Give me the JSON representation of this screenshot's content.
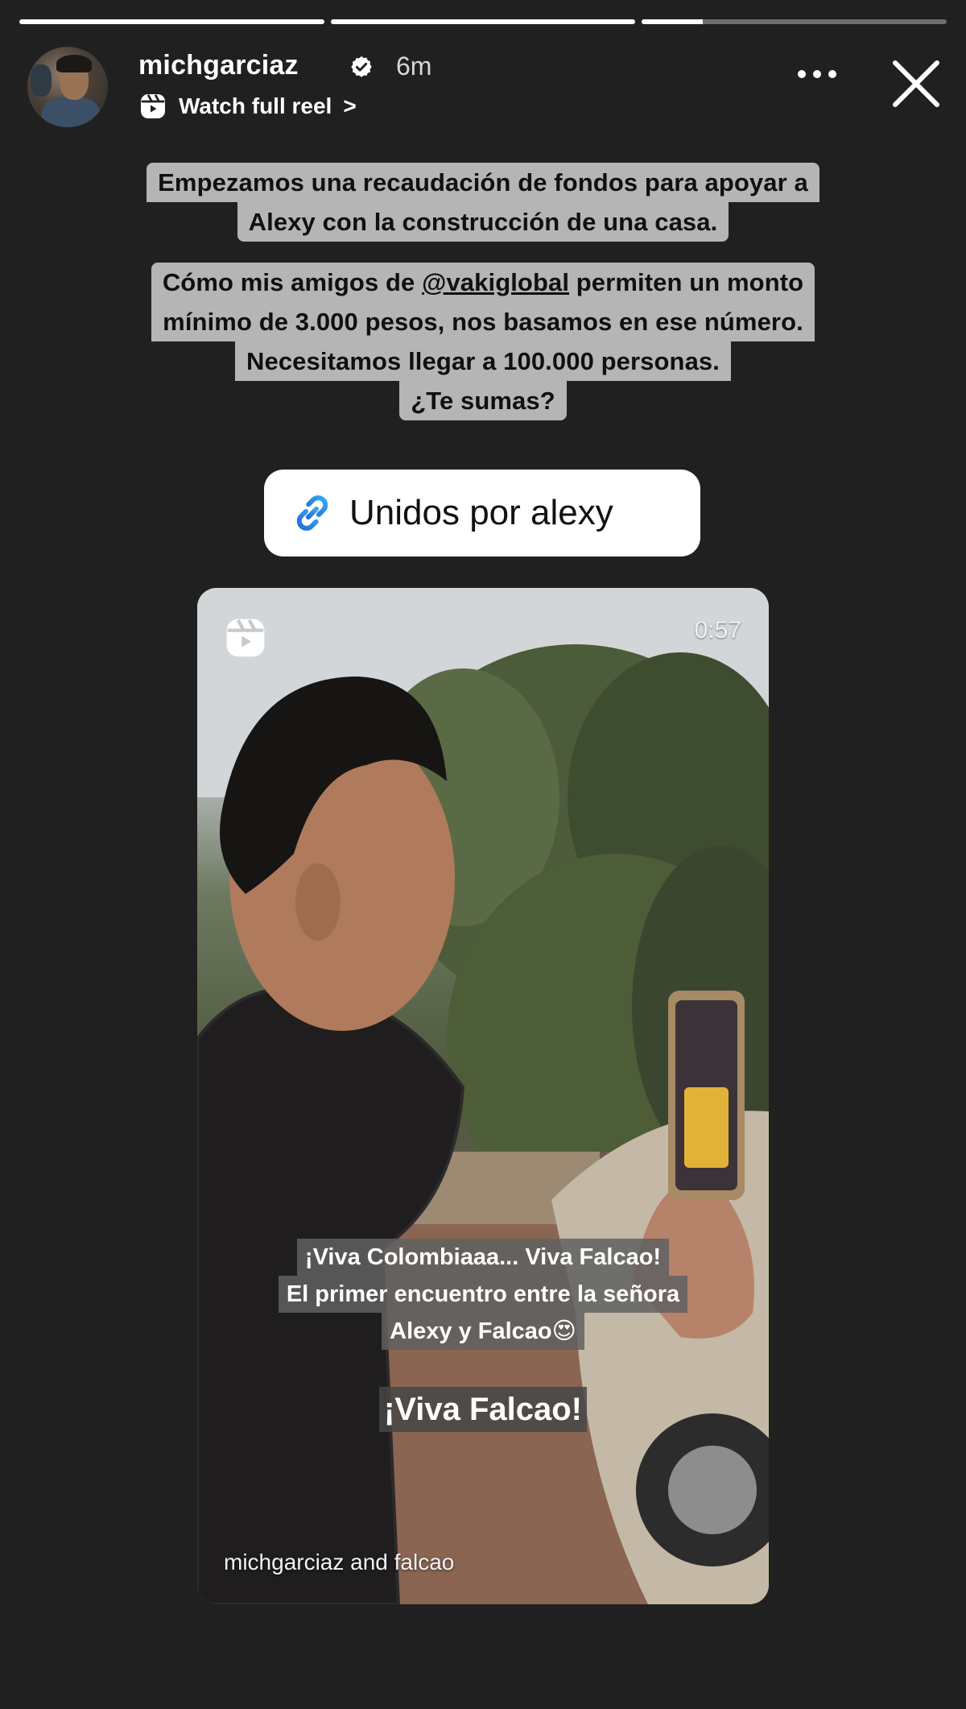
{
  "story": {
    "progress": [
      1.0,
      1.0,
      0.2
    ]
  },
  "header": {
    "username": "michgarciaz",
    "verified_icon": "verified-badge-icon",
    "time_ago": "6m",
    "reel_link_label": "Watch full reel",
    "reel_link_chevron": ">",
    "more_icon": "more-horizontal-icon",
    "close_icon": "close-icon"
  },
  "captions": {
    "block1": [
      "Empezamos una recaudación de fondos para apoyar a",
      "Alexy con la construcción de una casa."
    ],
    "block2_line1_pre": "Cómo mis amigos de ",
    "block2_mention": "@vakiglobal",
    "block2_line1_post": " permiten un monto",
    "block2_rest": [
      "mínimo de 3.000 pesos, nos basamos en ese número.",
      "Necesitamos llegar a 100.000 personas.",
      "¿Te sumas?"
    ]
  },
  "link_sticker": {
    "icon": "link-icon",
    "label": "Unidos por alexy",
    "accent": "#1a8fe3"
  },
  "reel": {
    "icon": "reels-icon",
    "duration": "0:57",
    "overlay_lines": [
      "¡Viva Colombiaaa... Viva Falcao!",
      "El primer encuentro entre la señora",
      "Alexy y Falcao😍"
    ],
    "big_caption": "¡Viva Falcao!",
    "credits": "michgarciaz and falcao"
  }
}
